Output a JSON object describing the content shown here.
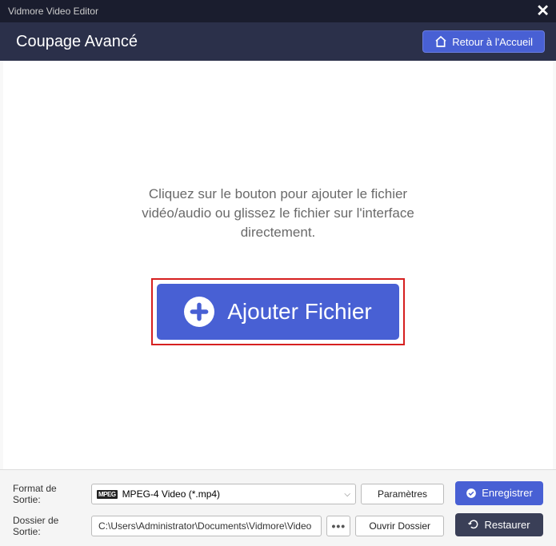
{
  "titlebar": {
    "app_name": "Vidmore Video Editor"
  },
  "header": {
    "title": "Coupage Avancé",
    "home_button": "Retour à l'Accueil"
  },
  "main": {
    "hint": "Cliquez sur le bouton pour ajouter le fichier vidéo/audio ou glissez le fichier sur l'interface directement.",
    "add_button": "Ajouter Fichier"
  },
  "footer": {
    "format_label": "Format de Sortie:",
    "format_value": "MPEG-4 Video (*.mp4)",
    "format_badge": "MPEG",
    "settings_button": "Paramètres",
    "folder_label": "Dossier de Sortie:",
    "folder_value": "C:\\Users\\Administrator\\Documents\\Vidmore\\Video",
    "browse_dots": "•••",
    "open_folder_button": "Ouvrir Dossier",
    "save_button": "Enregistrer",
    "restore_button": "Restaurer"
  }
}
